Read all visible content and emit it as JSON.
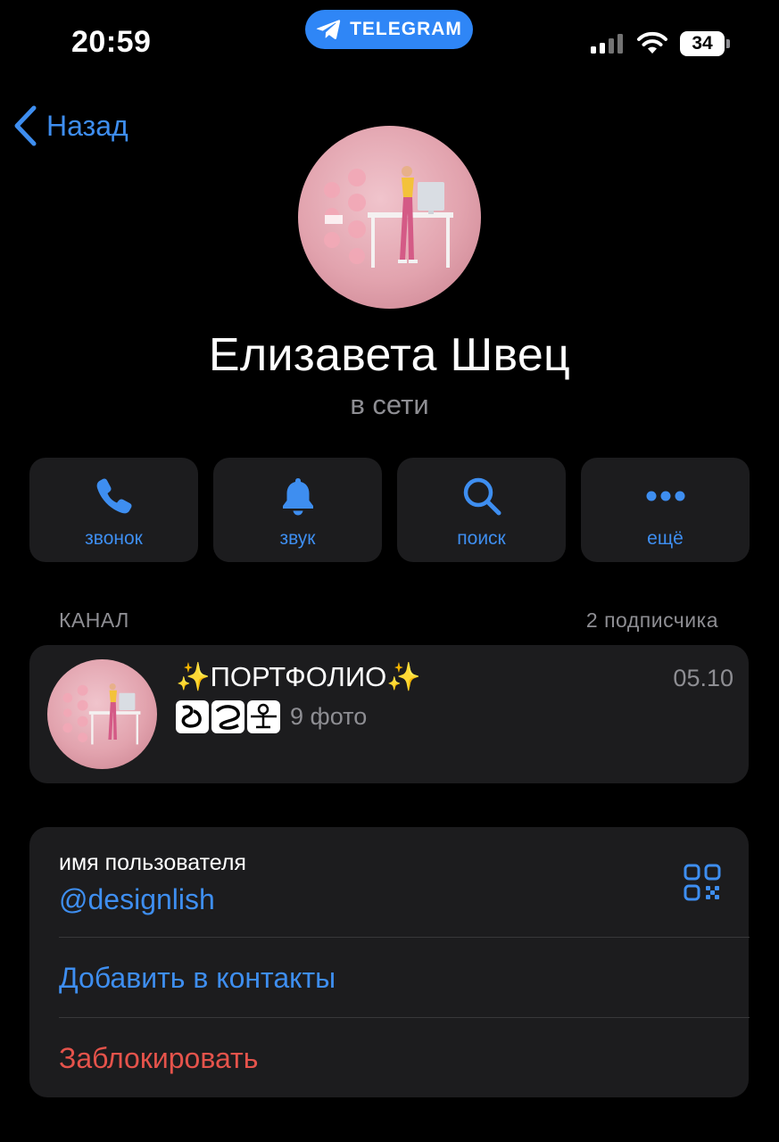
{
  "status_bar": {
    "time": "20:59",
    "app_pill": "TELEGRAM",
    "battery": "34"
  },
  "nav": {
    "back_label": "Назад"
  },
  "profile": {
    "name": "Елизавета Швец",
    "status": "в сети"
  },
  "actions": [
    {
      "label": "звонок",
      "icon": "phone-icon"
    },
    {
      "label": "звук",
      "icon": "bell-icon"
    },
    {
      "label": "поиск",
      "icon": "search-icon"
    },
    {
      "label": "ещё",
      "icon": "more-icon"
    }
  ],
  "channel_section": {
    "header": "КАНАЛ",
    "subscribers": "2 подписчика",
    "channel": {
      "title": "✨ПОРТФОЛИО✨",
      "date": "05.10",
      "subtitle": "9 фото"
    }
  },
  "info": {
    "username_label": "имя пользователя",
    "username": "@designlish",
    "add_contact": "Добавить в контакты",
    "block": "Заблокировать"
  },
  "colors": {
    "accent": "#3e8ef0",
    "danger": "#e5534b",
    "card": "#1c1c1e",
    "secondary_text": "#8e8e93"
  }
}
